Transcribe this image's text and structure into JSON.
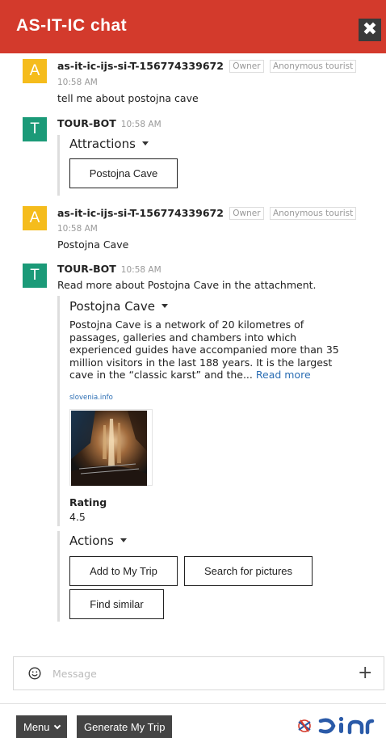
{
  "header": {
    "title": "AS-IT-IC chat",
    "close_label": "✖"
  },
  "messages": [
    {
      "avatar": "A",
      "sender": "as-it-ic-ijs-si-T-156774339672",
      "badges": [
        "Owner",
        "Anonymous tourist"
      ],
      "time": "10:58 AM",
      "text": "tell me about postojna cave"
    },
    {
      "avatar": "T",
      "sender": "TOUR-BOT",
      "time": "10:58 AM",
      "attachment": {
        "title": "Attractions",
        "buttons": [
          "Postojna Cave"
        ]
      }
    },
    {
      "avatar": "A",
      "sender": "as-it-ic-ijs-si-T-156774339672",
      "badges": [
        "Owner",
        "Anonymous tourist"
      ],
      "time": "10:58 AM",
      "text": "Postojna Cave"
    },
    {
      "avatar": "T",
      "sender": "TOUR-BOT",
      "time": "10:58 AM",
      "text": "Read more about Postojna Cave in the attachment.",
      "attachment": {
        "title": "Postojna Cave",
        "description": "Postojna Cave is a network of 20 kilometres of passages, galleries and chambers into which experienced guides have accompanied more than 35 million visitors in the last 188 years. It is the largest cave in the “classic karst” and the...",
        "read_more": "Read more",
        "source": "slovenia.info",
        "rating_label": "Rating",
        "rating_value": "4.5"
      },
      "actions": {
        "title": "Actions",
        "buttons": [
          "Add to My Trip",
          "Search for pictures",
          "Find similar"
        ]
      }
    }
  ],
  "composer": {
    "placeholder": "Message",
    "value": ""
  },
  "footer": {
    "menu_label": "Menu",
    "generate_label": "Generate My Trip",
    "logo_text": "DIN"
  },
  "colors": {
    "header": "#d33a2c",
    "user_avatar": "#f5bc1c",
    "bot_avatar": "#1b9a78",
    "dark_button": "#444444",
    "link": "#2a6db3"
  }
}
